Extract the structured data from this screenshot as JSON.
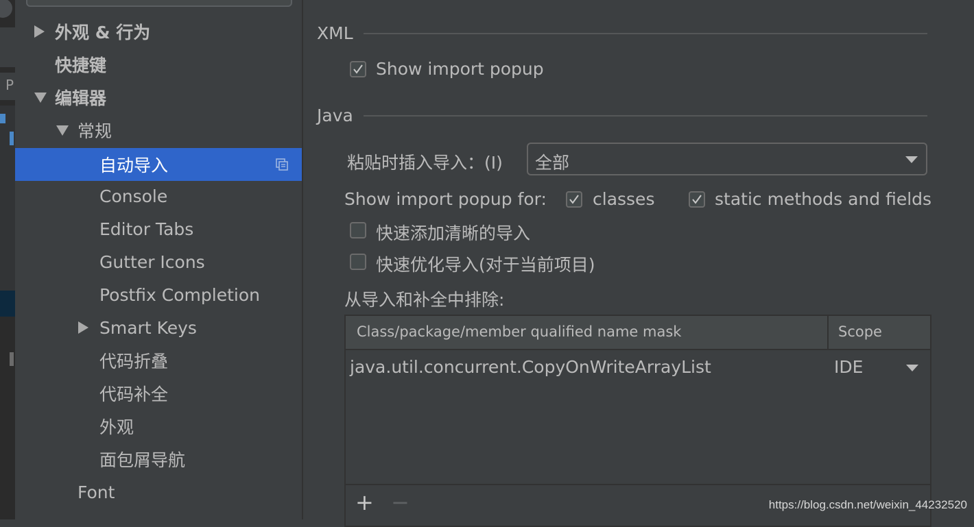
{
  "sidebar": {
    "items": [
      {
        "label": "外观 & 行为",
        "expanded": false
      },
      {
        "label": "快捷键"
      },
      {
        "label": "编辑器",
        "expanded": true
      },
      {
        "label": "常规",
        "expanded": true
      },
      {
        "label": "自动导入",
        "selected": true
      },
      {
        "label": "Console"
      },
      {
        "label": "Editor Tabs"
      },
      {
        "label": "Gutter Icons"
      },
      {
        "label": "Postfix Completion"
      },
      {
        "label": "Smart Keys",
        "expanded": false
      },
      {
        "label": "代码折叠"
      },
      {
        "label": "代码补全"
      },
      {
        "label": "外观"
      },
      {
        "label": "面包屑导航"
      },
      {
        "label": "Font"
      }
    ]
  },
  "xml": {
    "title": "XML",
    "show_import_popup": {
      "label": "Show import popup",
      "checked": true
    }
  },
  "java": {
    "title": "Java",
    "paste_insert_label": "粘贴时插入导入：(I)",
    "paste_insert_value": "全部",
    "show_popup_for_label": "Show import popup for:",
    "classes": {
      "label": "classes",
      "checked": true
    },
    "static_methods": {
      "label": "static methods and fields",
      "checked": true
    },
    "add_unambiguous": {
      "label": "快速添加清晰的导入",
      "checked": false
    },
    "optimize_imports": {
      "label": "快速优化导入(对于当前项目)",
      "checked": false
    },
    "exclude_label": "从导入和补全中排除:",
    "table": {
      "columns": [
        "Class/package/member qualified name mask",
        "Scope"
      ],
      "rows": [
        {
          "mask": "java.util.concurrent.CopyOnWriteArrayList",
          "scope": "IDE"
        }
      ],
      "add_label": "+",
      "remove_label": "−"
    }
  },
  "watermark": "https://blog.csdn.net/weixin_44232520",
  "colors": {
    "selection": "#2f65ca",
    "background": "#3c3f41",
    "text": "#bbbbbb"
  }
}
